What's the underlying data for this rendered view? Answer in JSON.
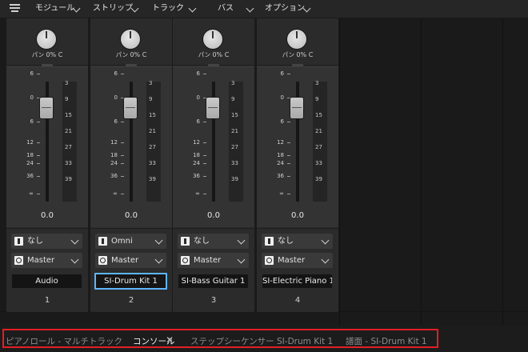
{
  "menu": {
    "items": [
      {
        "label": "モジュール"
      },
      {
        "label": "ストリップ"
      },
      {
        "label": "トラック"
      },
      {
        "label": "バス"
      },
      {
        "label": "オプション"
      }
    ]
  },
  "strips": [
    {
      "pan_label": "パン",
      "pan_value": "0% C",
      "volume": "0.0",
      "input": "なし",
      "output": "Master",
      "name": "Audio",
      "number": "1",
      "selected": false
    },
    {
      "pan_label": "パン",
      "pan_value": "0% C",
      "volume": "0.0",
      "input": "Omni",
      "output": "Master",
      "name": "SI-Drum Kit 1",
      "number": "2",
      "selected": true
    },
    {
      "pan_label": "パン",
      "pan_value": "0% C",
      "volume": "0.0",
      "input": "なし",
      "output": "Master",
      "name": "SI-Bass Guitar 1",
      "number": "3",
      "selected": false
    },
    {
      "pan_label": "パン",
      "pan_value": "0% C",
      "volume": "0.0",
      "input": "なし",
      "output": "Master",
      "name": "SI-Electric Piano 1",
      "number": "4",
      "selected": false
    }
  ],
  "fader_scale": [
    "6",
    "0",
    "6",
    "12",
    "18",
    "24",
    "36",
    "∞"
  ],
  "meter_scale": [
    "3",
    "9",
    "15",
    "21",
    "27",
    "33",
    "39"
  ],
  "tabs": [
    {
      "label": "ピアノロール - マルチトラック"
    },
    {
      "label": "コンソール"
    },
    {
      "label": "ステップシーケンサー SI-Drum Kit 1"
    },
    {
      "label": "譜面 - SI-Drum Kit 1"
    }
  ],
  "colors": {
    "selected_outline": "#5fb6ff",
    "highlight_box": "#e31e24"
  }
}
